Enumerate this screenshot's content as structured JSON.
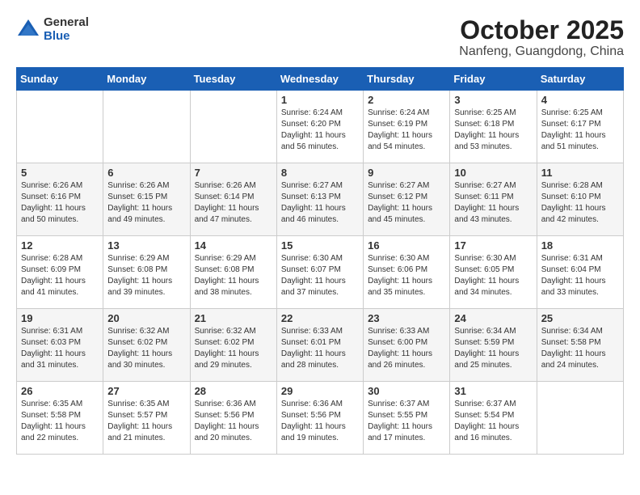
{
  "logo": {
    "general": "General",
    "blue": "Blue"
  },
  "title": {
    "month_year": "October 2025",
    "location": "Nanfeng, Guangdong, China"
  },
  "headers": [
    "Sunday",
    "Monday",
    "Tuesday",
    "Wednesday",
    "Thursday",
    "Friday",
    "Saturday"
  ],
  "weeks": [
    [
      {
        "num": "",
        "info": ""
      },
      {
        "num": "",
        "info": ""
      },
      {
        "num": "",
        "info": ""
      },
      {
        "num": "1",
        "info": "Sunrise: 6:24 AM\nSunset: 6:20 PM\nDaylight: 11 hours\nand 56 minutes."
      },
      {
        "num": "2",
        "info": "Sunrise: 6:24 AM\nSunset: 6:19 PM\nDaylight: 11 hours\nand 54 minutes."
      },
      {
        "num": "3",
        "info": "Sunrise: 6:25 AM\nSunset: 6:18 PM\nDaylight: 11 hours\nand 53 minutes."
      },
      {
        "num": "4",
        "info": "Sunrise: 6:25 AM\nSunset: 6:17 PM\nDaylight: 11 hours\nand 51 minutes."
      }
    ],
    [
      {
        "num": "5",
        "info": "Sunrise: 6:26 AM\nSunset: 6:16 PM\nDaylight: 11 hours\nand 50 minutes."
      },
      {
        "num": "6",
        "info": "Sunrise: 6:26 AM\nSunset: 6:15 PM\nDaylight: 11 hours\nand 49 minutes."
      },
      {
        "num": "7",
        "info": "Sunrise: 6:26 AM\nSunset: 6:14 PM\nDaylight: 11 hours\nand 47 minutes."
      },
      {
        "num": "8",
        "info": "Sunrise: 6:27 AM\nSunset: 6:13 PM\nDaylight: 11 hours\nand 46 minutes."
      },
      {
        "num": "9",
        "info": "Sunrise: 6:27 AM\nSunset: 6:12 PM\nDaylight: 11 hours\nand 45 minutes."
      },
      {
        "num": "10",
        "info": "Sunrise: 6:27 AM\nSunset: 6:11 PM\nDaylight: 11 hours\nand 43 minutes."
      },
      {
        "num": "11",
        "info": "Sunrise: 6:28 AM\nSunset: 6:10 PM\nDaylight: 11 hours\nand 42 minutes."
      }
    ],
    [
      {
        "num": "12",
        "info": "Sunrise: 6:28 AM\nSunset: 6:09 PM\nDaylight: 11 hours\nand 41 minutes."
      },
      {
        "num": "13",
        "info": "Sunrise: 6:29 AM\nSunset: 6:08 PM\nDaylight: 11 hours\nand 39 minutes."
      },
      {
        "num": "14",
        "info": "Sunrise: 6:29 AM\nSunset: 6:08 PM\nDaylight: 11 hours\nand 38 minutes."
      },
      {
        "num": "15",
        "info": "Sunrise: 6:30 AM\nSunset: 6:07 PM\nDaylight: 11 hours\nand 37 minutes."
      },
      {
        "num": "16",
        "info": "Sunrise: 6:30 AM\nSunset: 6:06 PM\nDaylight: 11 hours\nand 35 minutes."
      },
      {
        "num": "17",
        "info": "Sunrise: 6:30 AM\nSunset: 6:05 PM\nDaylight: 11 hours\nand 34 minutes."
      },
      {
        "num": "18",
        "info": "Sunrise: 6:31 AM\nSunset: 6:04 PM\nDaylight: 11 hours\nand 33 minutes."
      }
    ],
    [
      {
        "num": "19",
        "info": "Sunrise: 6:31 AM\nSunset: 6:03 PM\nDaylight: 11 hours\nand 31 minutes."
      },
      {
        "num": "20",
        "info": "Sunrise: 6:32 AM\nSunset: 6:02 PM\nDaylight: 11 hours\nand 30 minutes."
      },
      {
        "num": "21",
        "info": "Sunrise: 6:32 AM\nSunset: 6:02 PM\nDaylight: 11 hours\nand 29 minutes."
      },
      {
        "num": "22",
        "info": "Sunrise: 6:33 AM\nSunset: 6:01 PM\nDaylight: 11 hours\nand 28 minutes."
      },
      {
        "num": "23",
        "info": "Sunrise: 6:33 AM\nSunset: 6:00 PM\nDaylight: 11 hours\nand 26 minutes."
      },
      {
        "num": "24",
        "info": "Sunrise: 6:34 AM\nSunset: 5:59 PM\nDaylight: 11 hours\nand 25 minutes."
      },
      {
        "num": "25",
        "info": "Sunrise: 6:34 AM\nSunset: 5:58 PM\nDaylight: 11 hours\nand 24 minutes."
      }
    ],
    [
      {
        "num": "26",
        "info": "Sunrise: 6:35 AM\nSunset: 5:58 PM\nDaylight: 11 hours\nand 22 minutes."
      },
      {
        "num": "27",
        "info": "Sunrise: 6:35 AM\nSunset: 5:57 PM\nDaylight: 11 hours\nand 21 minutes."
      },
      {
        "num": "28",
        "info": "Sunrise: 6:36 AM\nSunset: 5:56 PM\nDaylight: 11 hours\nand 20 minutes."
      },
      {
        "num": "29",
        "info": "Sunrise: 6:36 AM\nSunset: 5:56 PM\nDaylight: 11 hours\nand 19 minutes."
      },
      {
        "num": "30",
        "info": "Sunrise: 6:37 AM\nSunset: 5:55 PM\nDaylight: 11 hours\nand 17 minutes."
      },
      {
        "num": "31",
        "info": "Sunrise: 6:37 AM\nSunset: 5:54 PM\nDaylight: 11 hours\nand 16 minutes."
      },
      {
        "num": "",
        "info": ""
      }
    ]
  ]
}
